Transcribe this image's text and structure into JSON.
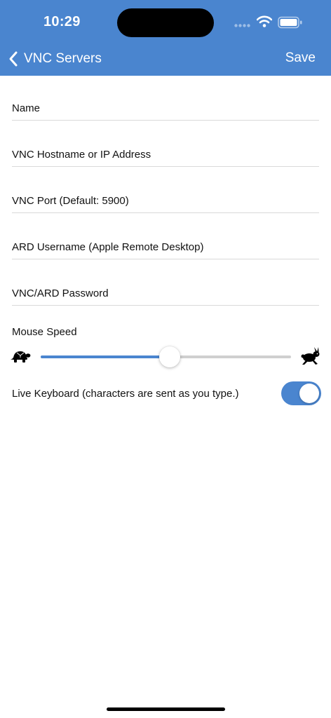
{
  "status_bar": {
    "time": "10:29"
  },
  "nav": {
    "back_label": "VNC Servers",
    "save_label": "Save"
  },
  "form": {
    "name_placeholder": "Name",
    "hostname_placeholder": "VNC Hostname or IP Address",
    "port_placeholder": "VNC Port (Default: 5900)",
    "ard_username_placeholder": "ARD Username (Apple Remote Desktop)",
    "password_placeholder": "VNC/ARD Password"
  },
  "mouse_speed": {
    "label": "Mouse Speed",
    "value_fraction": 0.5
  },
  "live_keyboard": {
    "label": "Live Keyboard (characters are sent as you type.)",
    "enabled": true
  },
  "colors": {
    "accent": "#4a85cf",
    "track": "#cfcfcf"
  },
  "icons": {
    "slow": "turtle-icon",
    "fast": "rabbit-icon",
    "back": "chevron-left-icon",
    "wifi": "wifi-icon",
    "battery": "battery-icon",
    "signal": "signal-icon"
  }
}
